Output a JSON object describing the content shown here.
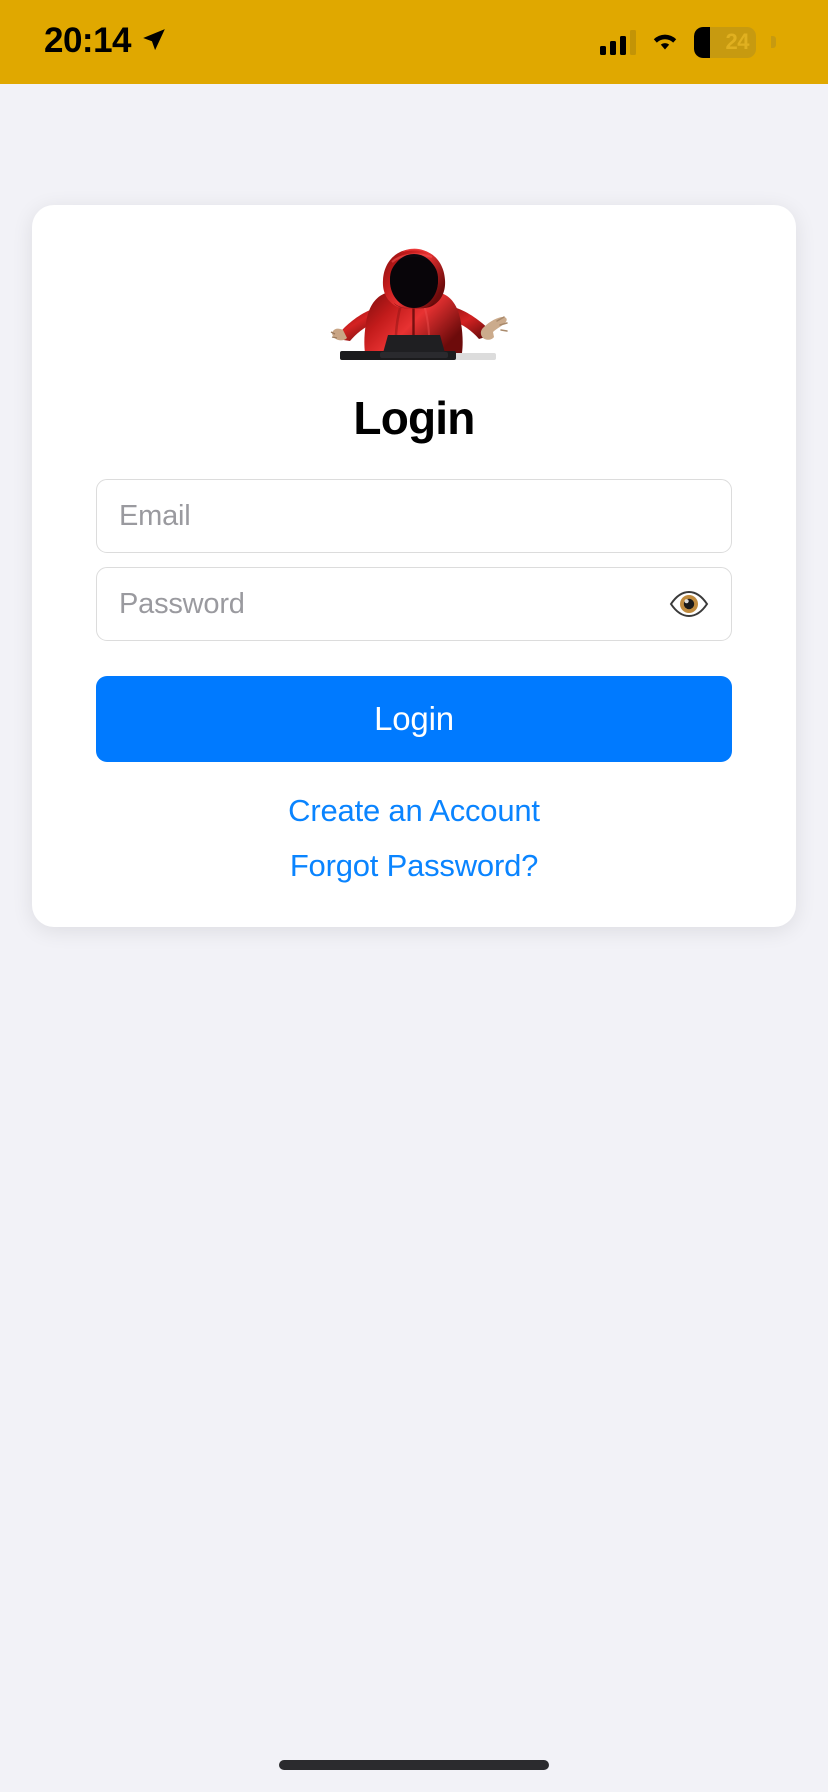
{
  "status_bar": {
    "time": "20:14",
    "location_icon": "location-arrow-icon",
    "cellular_icon": "cellular-signal-icon",
    "cellular_bars_filled": 3,
    "cellular_bars_total": 4,
    "wifi_icon": "wifi-icon",
    "battery_icon": "battery-icon",
    "battery_percent": "24",
    "background_color": "#e0a800",
    "text_color": "#000000"
  },
  "page": {
    "background_color": "#f2f2f7"
  },
  "card": {
    "logo": {
      "name": "hooded-figure-logo",
      "description": "hooded figure in red hoodie with shadowed face, arms outstretched over a laptop",
      "hood_color": "#b01616",
      "hood_highlight": "#e03030",
      "face_color": "#0d0a0c",
      "desk_color": "#1c1c1e"
    },
    "title": "Login",
    "fields": [
      {
        "name": "email-field",
        "placeholder": "Email",
        "value": "",
        "type": "email"
      },
      {
        "name": "password-field",
        "placeholder": "Password",
        "value": "",
        "type": "password",
        "trailing_icon": "eye-icon"
      }
    ],
    "primary_button": {
      "label": "Login",
      "background_color": "#007aff",
      "text_color": "#ffffff"
    },
    "links": [
      {
        "name": "create-account-link",
        "label": "Create an Account",
        "color": "#0a84ff"
      },
      {
        "name": "forgot-password-link",
        "label": "Forgot Password?",
        "color": "#0a84ff"
      }
    ]
  },
  "home_indicator": {
    "name": "home-indicator",
    "color": "#2b2b2e"
  }
}
